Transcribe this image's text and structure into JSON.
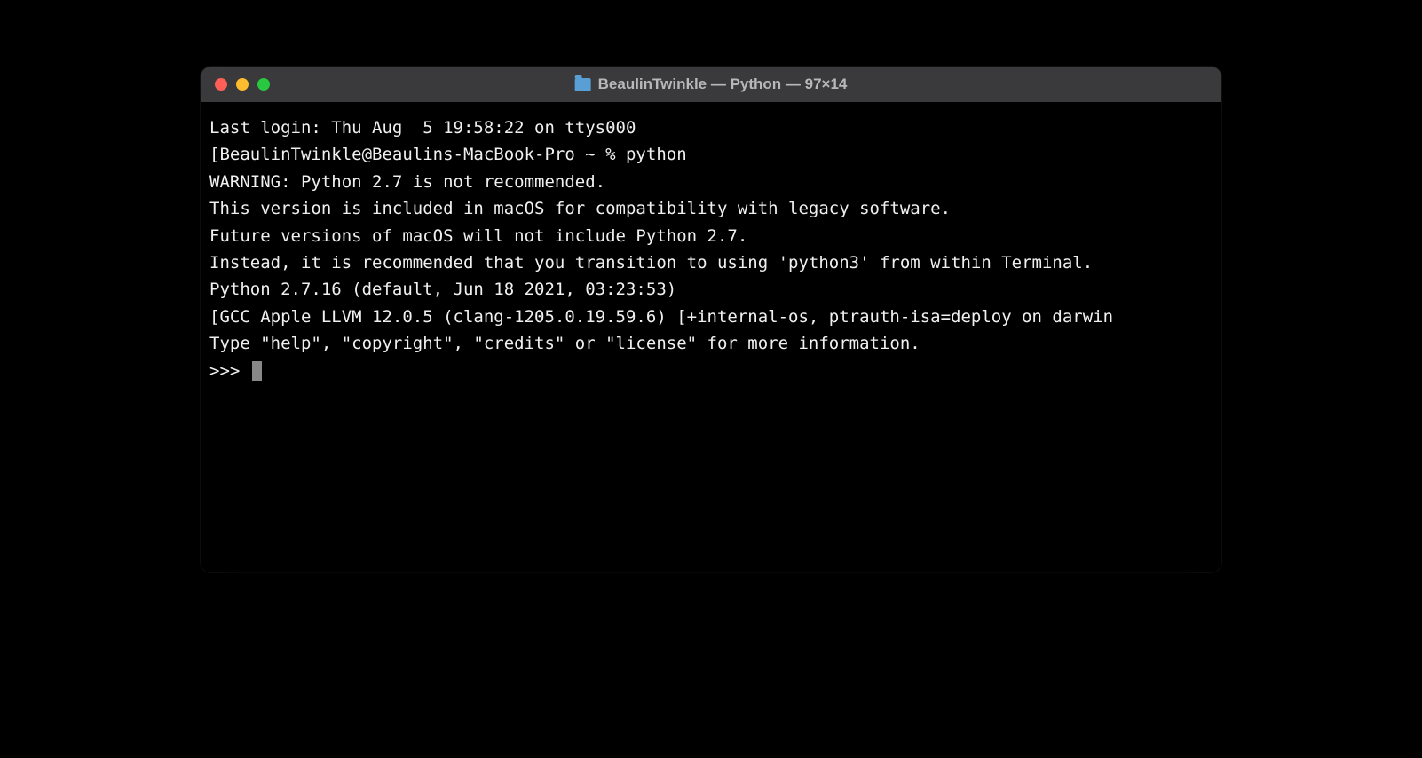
{
  "window": {
    "title": "BeaulinTwinkle — Python — 97×14"
  },
  "terminal": {
    "lines": [
      "Last login: Thu Aug  5 19:58:22 on ttys000",
      "[BeaulinTwinkle@Beaulins-MacBook-Pro ~ % python",
      "",
      "WARNING: Python 2.7 is not recommended.",
      "This version is included in macOS for compatibility with legacy software.",
      "Future versions of macOS will not include Python 2.7.",
      "Instead, it is recommended that you transition to using 'python3' from within Terminal.",
      "",
      "Python 2.7.16 (default, Jun 18 2021, 03:23:53)",
      "[GCC Apple LLVM 12.0.5 (clang-1205.0.19.59.6) [+internal-os, ptrauth-isa=deploy on darwin",
      "Type \"help\", \"copyright\", \"credits\" or \"license\" for more information.",
      ">>> "
    ]
  }
}
